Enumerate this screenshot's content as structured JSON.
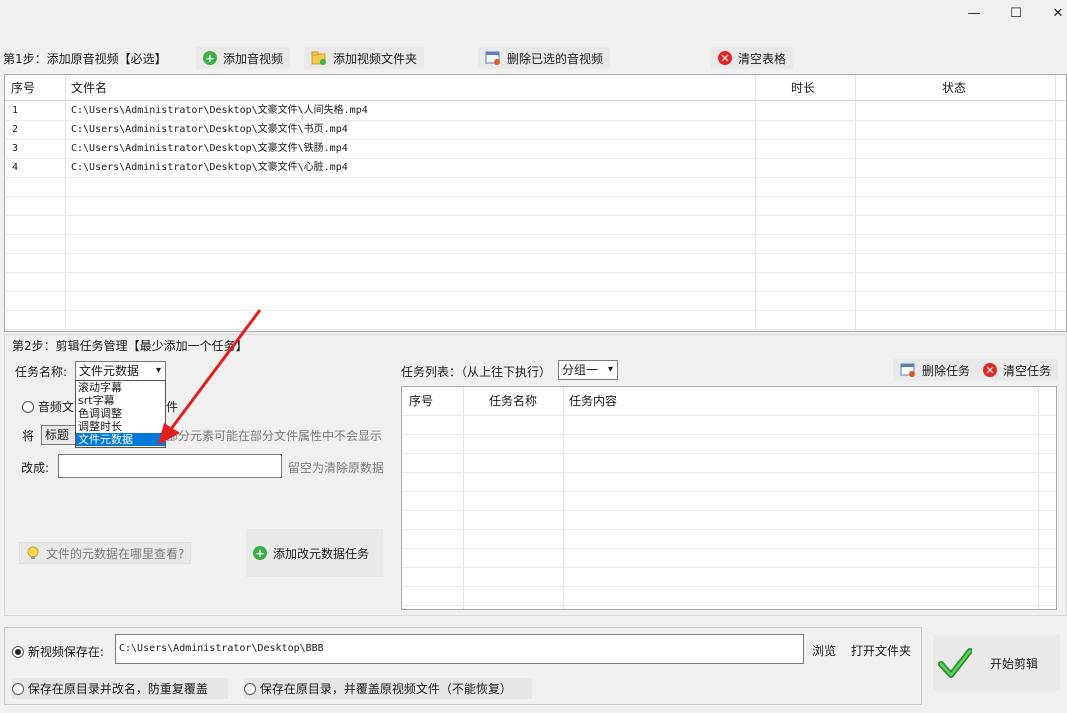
{
  "window": {
    "minimize": "—",
    "maximize": "☐",
    "close": "✕"
  },
  "step1": {
    "label": "第1步：添加原音视频【必选】",
    "add_av": "添加音视频",
    "add_folder": "添加视频文件夹",
    "delete_selected": "删除已选的音视频",
    "clear_table": "清空表格"
  },
  "files": {
    "columns": {
      "index": "序号",
      "name": "文件名",
      "duration": "时长",
      "status": "状态"
    },
    "rows": [
      {
        "index": "1",
        "name": "C:\\Users\\Administrator\\Desktop\\文豪文件\\人间失格.mp4"
      },
      {
        "index": "2",
        "name": "C:\\Users\\Administrator\\Desktop\\文豪文件\\书页.mp4"
      },
      {
        "index": "3",
        "name": "C:\\Users\\Administrator\\Desktop\\文豪文件\\铁肠.mp4"
      },
      {
        "index": "4",
        "name": "C:\\Users\\Administrator\\Desktop\\文豪文件\\心脏.mp4"
      }
    ]
  },
  "step2": {
    "label": "第2步：剪辑任务管理【最少添加一个任务】",
    "task_name_label": "任务名称:",
    "task_name_value": "文件元数据",
    "dropdown_options": [
      "滚动字幕",
      "srt字幕",
      "色调调整",
      "调整时长",
      "文件元数据"
    ],
    "radio_audio": "音频文",
    "radio_other_suffix": "件",
    "jiang_label": "将",
    "field_value": "标题",
    "field_hint": "部分元素可能在部分文件属性中不会显示",
    "change_label": "改成:",
    "change_hint": "留空为清除原数据",
    "metadata_help": "文件的元数据在哪里查看?",
    "add_task": "添加改元数据任务",
    "task_list_label": "任务列表：（从上往下执行）",
    "group_value": "分组一",
    "delete_task": "删除任务",
    "clear_tasks": "清空任务",
    "task_columns": {
      "index": "序号",
      "name": "任务名称",
      "content": "任务内容"
    }
  },
  "output": {
    "save_new_label": "新视频保存在:",
    "save_path": "C:\\Users\\Administrator\\Desktop\\BBB",
    "browse": "浏览",
    "open_folder": "打开文件夹",
    "save_rename": "保存在原目录并改名，防重复覆盖",
    "save_overwrite": "保存在原目录，并覆盖原视频文件（不能恢复）",
    "start": "开始剪辑"
  }
}
